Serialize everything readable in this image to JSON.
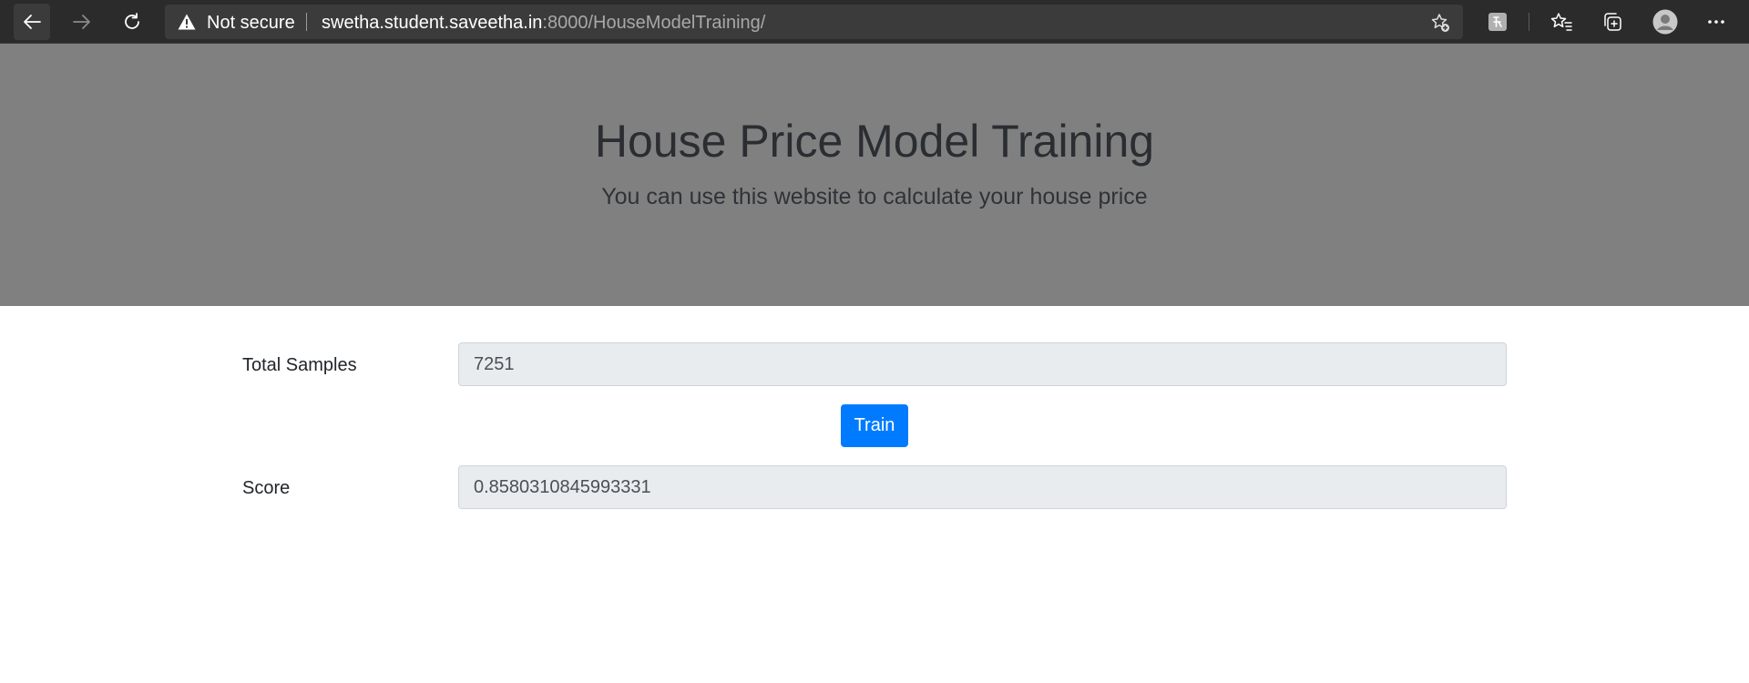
{
  "browser": {
    "security_label": "Not secure",
    "url_host": "swetha.student.saveetha.in",
    "url_rest": ":8000/HouseModelTraining/",
    "icons": [
      "back-arrow-icon",
      "forward-arrow-icon",
      "reload-icon",
      "warning-icon",
      "add-favorite-icon",
      "extension-icon",
      "favorites-icon",
      "collections-icon",
      "profile-icon",
      "more-icon"
    ]
  },
  "jumbotron": {
    "title": "House Price Model Training",
    "subtitle": "You can use this website to calculate your house price",
    "background": "#808080"
  },
  "form": {
    "samples_label": "Total Samples",
    "samples_value": "7251",
    "train_label": "Train",
    "score_label": "Score",
    "score_value": "0.8580310845993331"
  },
  "colors": {
    "primary": "#007bff",
    "input_bg": "#e9ecef"
  }
}
